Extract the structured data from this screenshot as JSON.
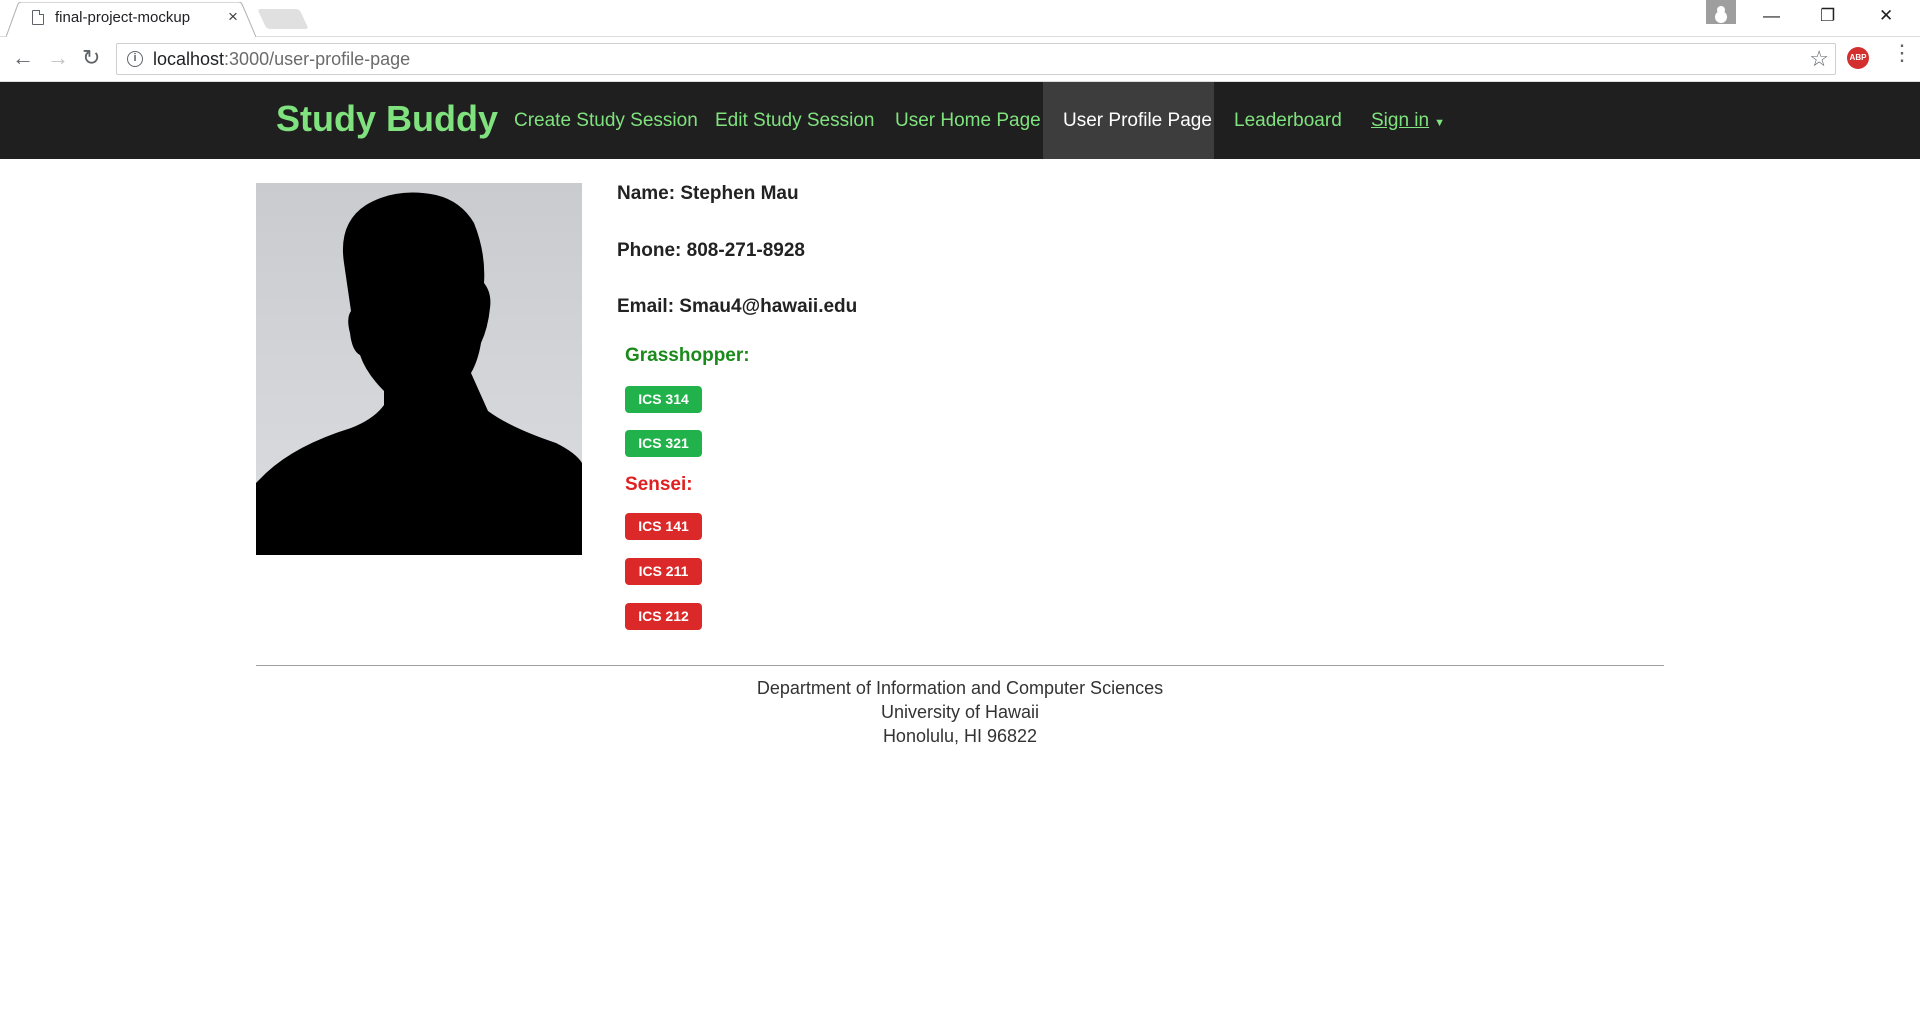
{
  "browser": {
    "tab_title": "final-project-mockup",
    "tab_close": "×",
    "url_host": "localhost",
    "url_path": ":3000/user-profile-page",
    "window_controls": {
      "minimize": "—",
      "restore": "❐",
      "close": "✕"
    },
    "back": "←",
    "forward": "→",
    "reload": "↻",
    "info": "i",
    "star": "☆",
    "abp": "ABP",
    "menu": "⋮"
  },
  "navbar": {
    "brand": "Study Buddy",
    "links": [
      {
        "label": "Create Study Session"
      },
      {
        "label": "Edit Study Session"
      },
      {
        "label": "User Home Page"
      },
      {
        "label": "User Profile Page",
        "active": true
      },
      {
        "label": "Leaderboard"
      },
      {
        "label": "Sign in"
      }
    ],
    "caret": "▼"
  },
  "profile": {
    "name": "Name: Stephen Mau",
    "phone": "Phone: 808-271-8928",
    "email": "Email: Smau4@hawaii.edu",
    "grasshopper_label": "Grasshopper:",
    "grasshopper_courses": [
      "ICS 314",
      "ICS 321"
    ],
    "sensei_label": "Sensei:",
    "sensei_courses": [
      "ICS 141",
      "ICS 211",
      "ICS 212"
    ]
  },
  "footer": {
    "lines": [
      "Department of Information and Computer Sciences",
      "University of Hawaii",
      "Honolulu, HI 96822"
    ]
  },
  "colors": {
    "navbar_bg": "#1f1f1f",
    "brand_green": "#80e27e",
    "grasshopper_green": "#22b24c",
    "sensei_red": "#db2828"
  }
}
